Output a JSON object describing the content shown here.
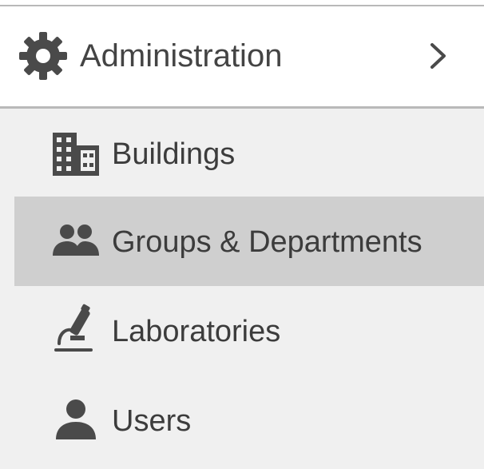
{
  "menu": {
    "section": {
      "label": "Administration",
      "icon": "gear-icon",
      "expand_indicator": "chevron-right-icon"
    },
    "items": [
      {
        "label": "Buildings",
        "icon": "building-icon",
        "active": false
      },
      {
        "label": "Groups & Departments",
        "icon": "group-icon",
        "active": true
      },
      {
        "label": "Laboratories",
        "icon": "microscope-icon",
        "active": false
      },
      {
        "label": "Users",
        "icon": "user-icon",
        "active": false
      }
    ]
  },
  "colors": {
    "header_bg": "#ffffff",
    "submenu_bg": "#f0f0f0",
    "active_bg": "#cfcfcf",
    "text": "#3c3c3c",
    "icon": "#4a4a4a",
    "divider": "#b9b9b9"
  }
}
